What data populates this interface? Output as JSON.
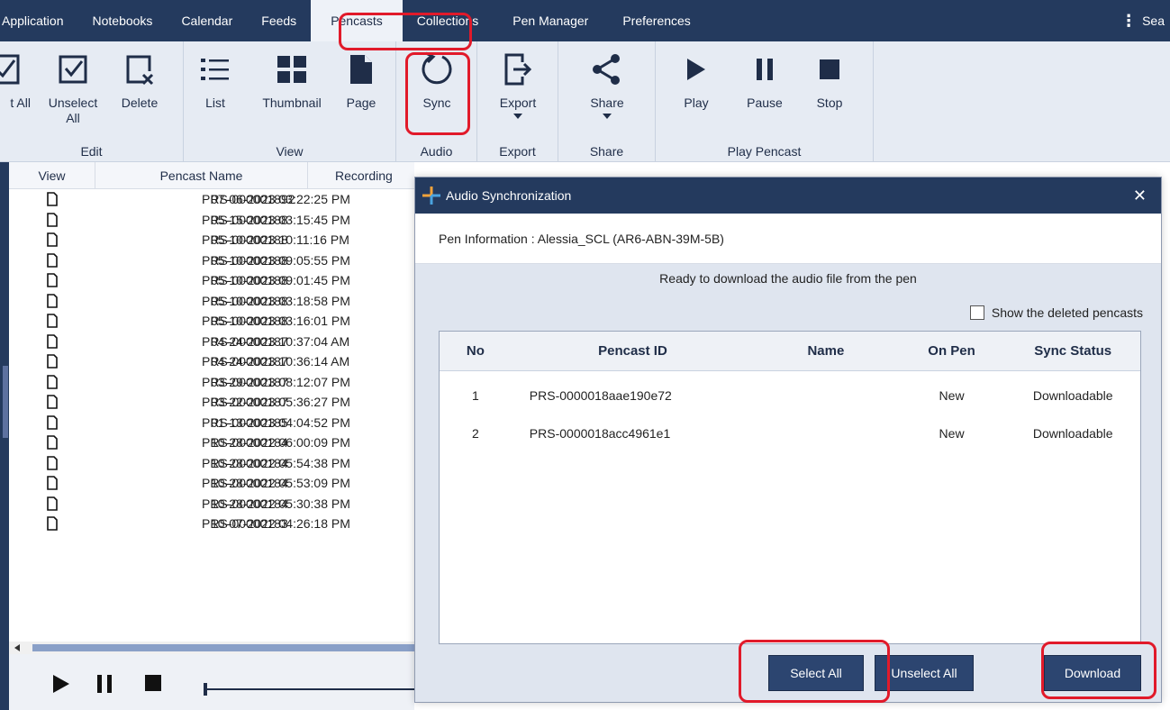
{
  "menubar": {
    "tabs": [
      "Application",
      "Notebooks",
      "Calendar",
      "Feeds",
      "Pencasts",
      "Collections",
      "Pen Manager",
      "Preferences"
    ],
    "active_tab": "Pencasts",
    "search_label": "Sea"
  },
  "ribbon": {
    "edit": {
      "select_all": "t All",
      "unselect_all_1": "Unselect",
      "unselect_all_2": "All",
      "delete": "Delete",
      "group": "Edit"
    },
    "view": {
      "list": "List",
      "thumbnail": "Thumbnail",
      "page": "Page",
      "group": "View"
    },
    "audio": {
      "sync": "Sync",
      "group": "Audio"
    },
    "export": {
      "export": "Export",
      "group": "Export"
    },
    "share": {
      "share": "Share",
      "group": "Share"
    },
    "play": {
      "play": "Play",
      "pause": "Pause",
      "stop": "Stop",
      "group": "Play Pencast"
    }
  },
  "list": {
    "headers": {
      "view": "View",
      "name": "Pencast Name",
      "recording": "Recording"
    },
    "rows": [
      {
        "date": "07-06-2023 03:22:25 PM",
        "id": "PRS-000001892"
      },
      {
        "date": "05-15-2023 03:15:45 PM",
        "id": "PRS-00000188"
      },
      {
        "date": "05-10-2023 10:11:16 PM",
        "id": "PRS-00000188"
      },
      {
        "date": "05-10-2023 09:05:55 PM",
        "id": "PRS-00000188"
      },
      {
        "date": "05-10-2023 09:01:45 PM",
        "id": "PRS-00000188"
      },
      {
        "date": "05-10-2023 03:18:58 PM",
        "id": "PRS-00000188"
      },
      {
        "date": "05-10-2023 03:16:01 PM",
        "id": "PRS-00000188"
      },
      {
        "date": "04-24-2023 10:37:04 AM",
        "id": "PRS-00000187"
      },
      {
        "date": "04-24-2023 10:36:14 AM",
        "id": "PRS-00000187"
      },
      {
        "date": "03-29-2023 08:12:07 PM",
        "id": "PRS-00000187"
      },
      {
        "date": "03-22-2023 05:36:27 PM",
        "id": "PRS-00000187"
      },
      {
        "date": "01-13-2023 04:04:52 PM",
        "id": "PRS-00000185"
      },
      {
        "date": "10-28-2022 06:00:09 PM",
        "id": "PRS-00000184"
      },
      {
        "date": "10-28-2022 05:54:38 PM",
        "id": "PRS-00000184"
      },
      {
        "date": "10-28-2022 05:53:09 PM",
        "id": "PRS-00000184"
      },
      {
        "date": "10-28-2022 05:30:38 PM",
        "id": "PRS-00000184"
      },
      {
        "date": "10-07-2022 04:26:18 PM",
        "id": "PRS-00000183"
      }
    ]
  },
  "modal": {
    "title": "Audio Synchronization",
    "pen_info": "Pen Information : Alessia_SCL (AR6-ABN-39M-5B)",
    "status": "Ready to download the audio file from the pen",
    "show_deleted": "Show the deleted pencasts",
    "columns": {
      "no": "No",
      "id": "Pencast ID",
      "name": "Name",
      "on_pen": "On Pen",
      "sync": "Sync Status"
    },
    "rows": [
      {
        "no": "1",
        "id": "PRS-0000018aae190e72",
        "name": "",
        "on_pen": "New",
        "sync": "Downloadable"
      },
      {
        "no": "2",
        "id": "PRS-0000018acc4961e1",
        "name": "",
        "on_pen": "New",
        "sync": "Downloadable"
      }
    ],
    "select_all": "Select All",
    "unselect_all": "Unselect All",
    "download": "Download"
  },
  "colors": {
    "navy": "#243a5e",
    "button": "#2c4570",
    "annotation": "#e11a2a"
  }
}
